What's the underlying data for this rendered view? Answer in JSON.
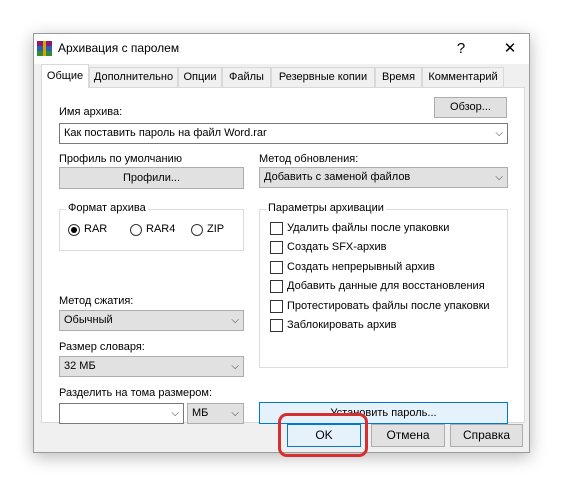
{
  "window": {
    "title": "Архивация с паролем",
    "help_glyph": "?",
    "close_glyph": "✕"
  },
  "tabs": [
    {
      "label": "Общие"
    },
    {
      "label": "Дополнительно"
    },
    {
      "label": "Опции"
    },
    {
      "label": "Файлы"
    },
    {
      "label": "Резервные копии"
    },
    {
      "label": "Время"
    },
    {
      "label": "Комментарий"
    }
  ],
  "archive_name": {
    "label": "Имя архива:",
    "value": "Как поставить пароль на файл Word.rar",
    "browse_label": "Обзор..."
  },
  "profile": {
    "label": "Профиль по умолчанию",
    "button_label": "Профили..."
  },
  "update_method": {
    "label": "Метод обновления:",
    "value": "Добавить с заменой файлов"
  },
  "archive_format": {
    "label": "Формат архива",
    "options": [
      "RAR",
      "RAR4",
      "ZIP"
    ],
    "selected": "RAR"
  },
  "compression": {
    "label": "Метод сжатия:",
    "value": "Обычный"
  },
  "dictionary": {
    "label": "Размер словаря:",
    "value": "32 МБ"
  },
  "split": {
    "label": "Разделить на тома размером:",
    "value": "",
    "unit": "МБ"
  },
  "archive_options": {
    "label": "Параметры архивации",
    "items": [
      {
        "label": "Удалить файлы после упаковки",
        "checked": false
      },
      {
        "label": "Создать SFX-архив",
        "checked": false
      },
      {
        "label": "Создать непрерывный архив",
        "checked": false
      },
      {
        "label": "Добавить данные для восстановления",
        "checked": false
      },
      {
        "label": "Протестировать файлы после упаковки",
        "checked": false
      },
      {
        "label": "Заблокировать архив",
        "checked": false
      }
    ]
  },
  "set_password_label": "Установить пароль...",
  "footer": {
    "ok_label": "OK",
    "cancel_label": "Отмена",
    "help_label": "Справка"
  },
  "colors": {
    "highlight": "#d62f2f",
    "accent": "#0078d7"
  }
}
